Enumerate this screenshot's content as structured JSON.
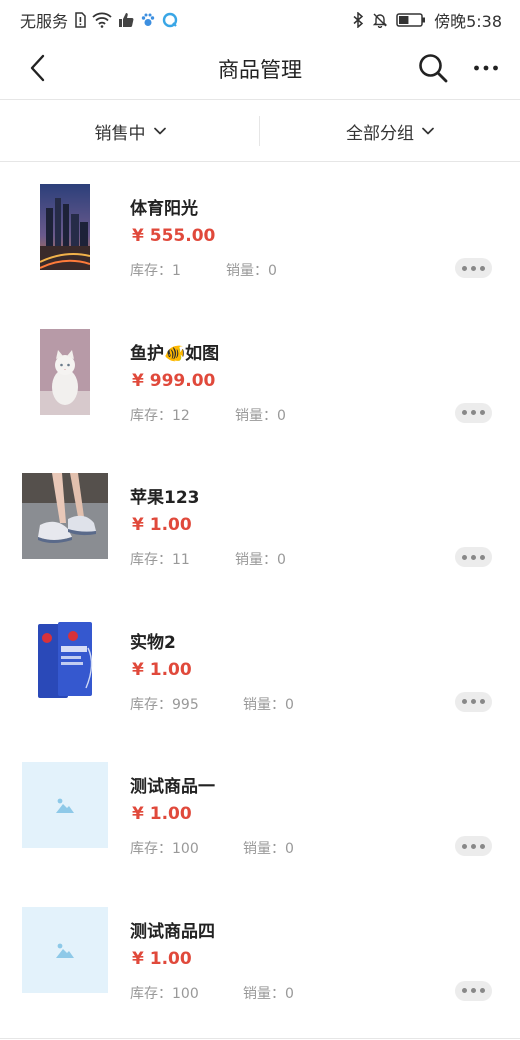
{
  "status_bar": {
    "carrier": "无服务",
    "time": "傍晚5:38",
    "battery_level": 0.45
  },
  "header": {
    "title": "商品管理"
  },
  "filters": {
    "status_label": "销售中",
    "group_label": "全部分组"
  },
  "products": [
    {
      "name": "体育阳光",
      "price": "¥ 555.00",
      "stock": "库存：1",
      "sales": "销量：0",
      "image": "city-photo"
    },
    {
      "name": "鱼护🐠如图",
      "price": "¥ 999.00",
      "stock": "库存：12",
      "sales": "销量：0",
      "image": "cat-photo"
    },
    {
      "name": "苹果123",
      "price": "¥ 1.00",
      "stock": "库存：11",
      "sales": "销量：0",
      "image": "sneaker-photo"
    },
    {
      "name": "实物2",
      "price": "¥ 1.00",
      "stock": "库存：995",
      "sales": "销量：0",
      "image": "mask-pack-photo"
    },
    {
      "name": "测试商品一",
      "price": "¥ 1.00",
      "stock": "库存：100",
      "sales": "销量：0",
      "image": "placeholder-image"
    },
    {
      "name": "测试商品四",
      "price": "¥ 1.00",
      "stock": "库存：100",
      "sales": "销量：0",
      "image": "placeholder-image"
    }
  ],
  "colors": {
    "price": "#e0493b",
    "muted_text": "#999999",
    "placeholder_bg": "#e3f2fb",
    "placeholder_icon": "#8ec9e8"
  }
}
